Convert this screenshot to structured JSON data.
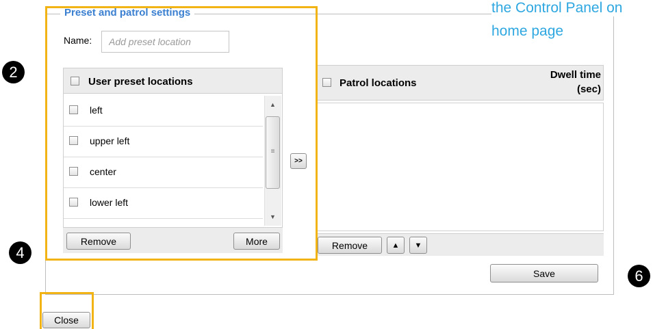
{
  "section": {
    "legend": "Preset and patrol settings"
  },
  "note": {
    "line1": "the Control Panel on",
    "line2": "home page"
  },
  "steps": {
    "s2": "2",
    "s4": "4",
    "s6": "6"
  },
  "name_field": {
    "label": "Name:",
    "placeholder": "Add preset location",
    "value": ""
  },
  "user_presets": {
    "header": "User preset locations",
    "items": [
      {
        "label": "left"
      },
      {
        "label": "upper left"
      },
      {
        "label": "center"
      },
      {
        "label": "lower left"
      }
    ],
    "remove_label": "Remove",
    "more_label": "More"
  },
  "transfer": {
    "label": ">>"
  },
  "patrol": {
    "header": "Patrol locations",
    "dwell_line1": "Dwell time",
    "dwell_line2": "(sec)",
    "remove_label": "Remove",
    "up_label": "▲",
    "down_label": "▼"
  },
  "save_label": "Save",
  "close_label": "Close",
  "colors": {
    "accent": "#3a7fd0",
    "highlight": "#f1b414",
    "note": "#2ea7e0"
  }
}
